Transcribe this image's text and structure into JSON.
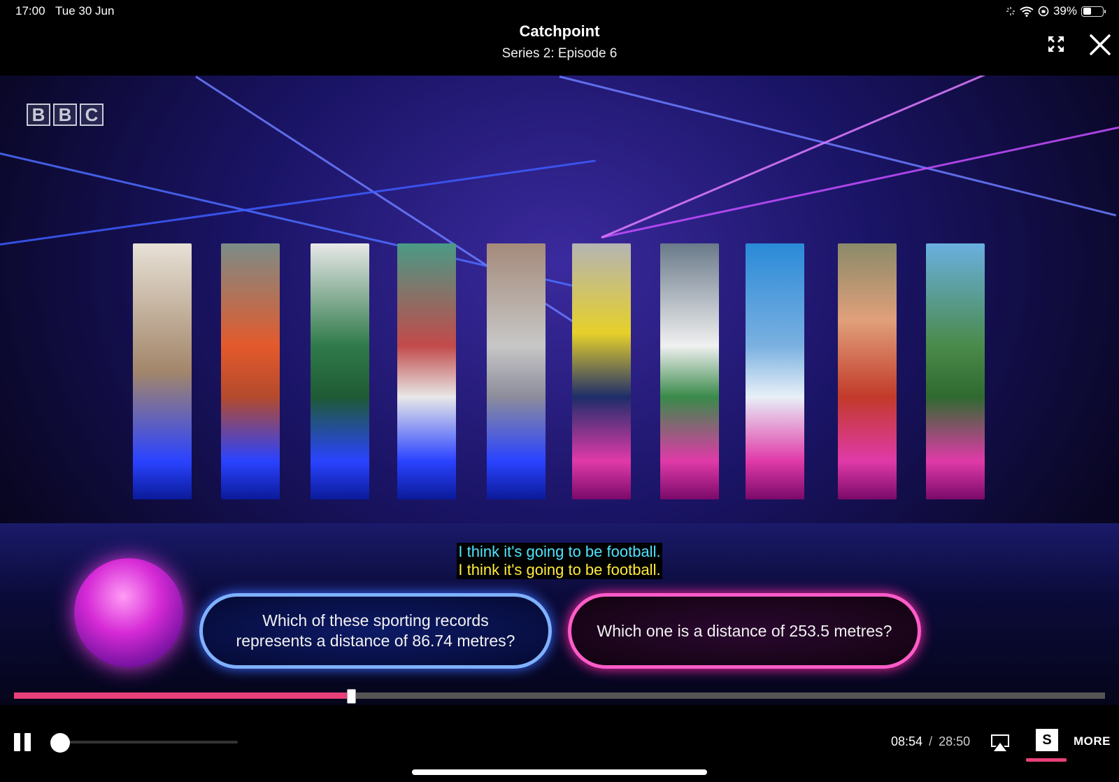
{
  "status_bar": {
    "time": "17:00",
    "date": "Tue 30 Jun",
    "battery": "39%"
  },
  "header": {
    "title": "Catchpoint",
    "subtitle": "Series 2: Episode 6"
  },
  "video": {
    "channel_logo": [
      "B",
      "B",
      "C"
    ],
    "question_left_line1": "Which of these sporting records",
    "question_left_line2": "represents a distance of 86.74 metres?",
    "question_right": "Which one is a distance of 253.5 metres?"
  },
  "captions": {
    "line1": "I think it's going to be football.",
    "line2": "I think it's going to be football."
  },
  "playback": {
    "progress_fraction": 0.309,
    "elapsed": "08:54",
    "separator": "/",
    "duration": "28:50",
    "subtitles_label": "S",
    "more_label": "MORE"
  },
  "colors": {
    "accent_pink": "#e8407a",
    "caption_cyan": "#4fe4ff",
    "caption_yellow": "#ffeb3b"
  },
  "icons": {
    "expand": "expand-icon",
    "close": "close-icon",
    "pause": "pause-icon",
    "airplay": "airplay-icon",
    "wifi": "wifi-icon",
    "battery": "battery-icon"
  }
}
